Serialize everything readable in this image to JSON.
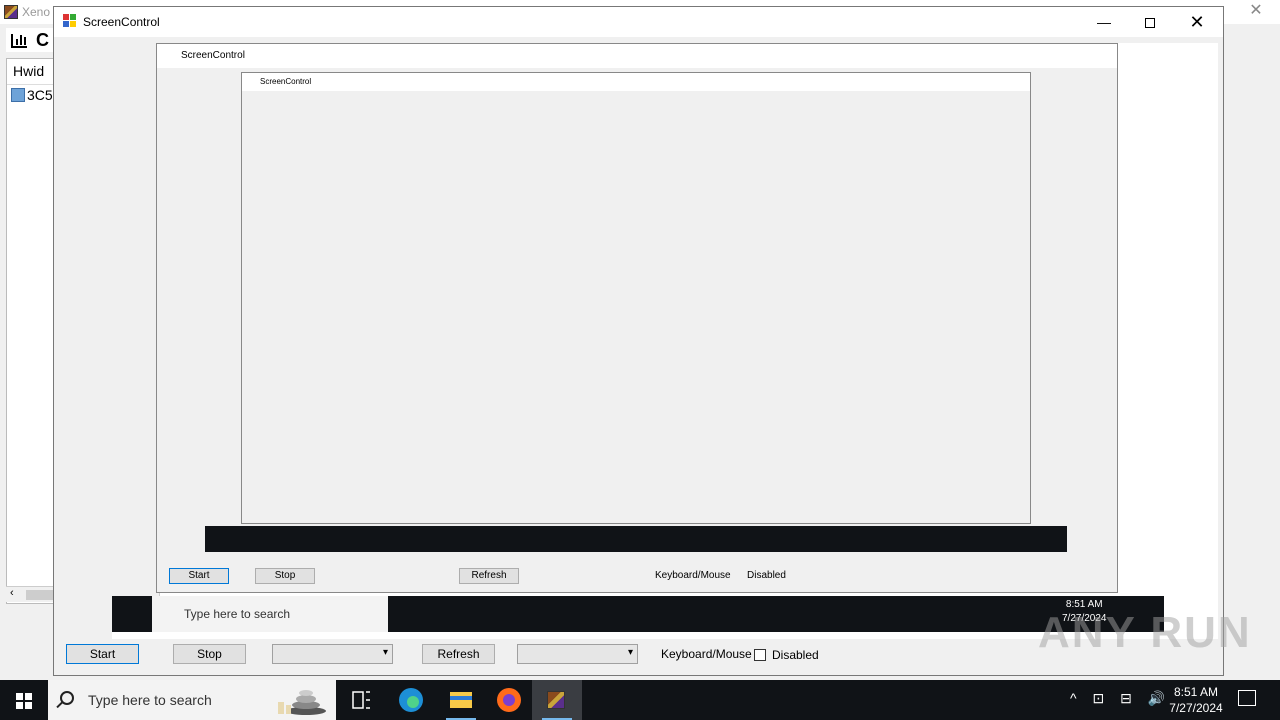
{
  "background_app": {
    "title": "Xeno",
    "tab_label": "C",
    "list_header": "Hwid",
    "list_first_row": "3C5"
  },
  "screen_control": {
    "title": "ScreenControl",
    "buttons": {
      "start": "Start",
      "stop": "Stop",
      "refresh": "Refresh"
    },
    "keyboard_mouse_label": "Keyboard/Mouse",
    "disabled_label": "Disabled"
  },
  "taskbar": {
    "search_placeholder": "Type here to search",
    "time": "8:51 AM",
    "date": "7/27/2024"
  },
  "watermark": "ANY RUN",
  "colors": {
    "taskbar": "#101317",
    "accent": "#0078d7",
    "window_bg": "#f0f0f0"
  }
}
